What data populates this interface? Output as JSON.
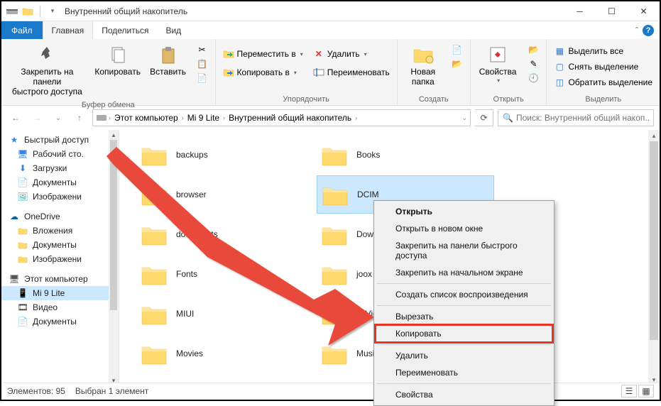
{
  "title": "Внутренний общий накопитель",
  "tabs": {
    "file": "Файл",
    "home": "Главная",
    "share": "Поделиться",
    "view": "Вид"
  },
  "ribbon": {
    "clipboard": {
      "label": "Буфер обмена",
      "pin": "Закрепить на панели\nбыстрого доступа",
      "copy": "Копировать",
      "paste": "Вставить"
    },
    "organize": {
      "label": "Упорядочить",
      "move": "Переместить в",
      "copyto": "Копировать в",
      "delete": "Удалить",
      "rename": "Переименовать"
    },
    "new": {
      "label": "Создать",
      "newfolder": "Новая\nпапка"
    },
    "open": {
      "label": "Открыть",
      "properties": "Свойства"
    },
    "select": {
      "label": "Выделить",
      "all": "Выделить все",
      "none": "Снять выделение",
      "invert": "Обратить выделение"
    }
  },
  "breadcrumb": [
    "Этот компьютер",
    "Mi 9 Lite",
    "Внутренний общий накопитель"
  ],
  "search_placeholder": "Поиск: Внутренний общий накоп...",
  "sidebar": {
    "quick": {
      "root": "Быстрый доступ",
      "items": [
        "Рабочий сто.",
        "Загрузки",
        "Документы",
        "Изображени"
      ]
    },
    "onedrive": {
      "root": "OneDrive",
      "items": [
        "Вложения",
        "Документы",
        "Изображени"
      ]
    },
    "pc": {
      "root": "Этот компьютер",
      "items": [
        "Mi 9 Lite",
        "Видео",
        "Документы"
      ]
    }
  },
  "folders_col1": [
    "backups",
    "browser",
    "documents",
    "Fonts",
    "MIUI",
    "Movies"
  ],
  "folders_col2": [
    "Books",
    "DCIM",
    "Download",
    "joox",
    "MiVideo",
    "Music"
  ],
  "selected_folder": "DCIM",
  "context_menu": {
    "open": "Открыть",
    "open_new": "Открыть в новом окне",
    "pin_quick": "Закрепить на панели быстрого доступа",
    "pin_start": "Закрепить на начальном экране",
    "playlist": "Создать список воспроизведения",
    "cut": "Вырезать",
    "copy": "Копировать",
    "delete": "Удалить",
    "rename": "Переименовать",
    "props": "Свойства"
  },
  "status": {
    "count": "Элементов: 95",
    "selected": "Выбран 1 элемент"
  }
}
